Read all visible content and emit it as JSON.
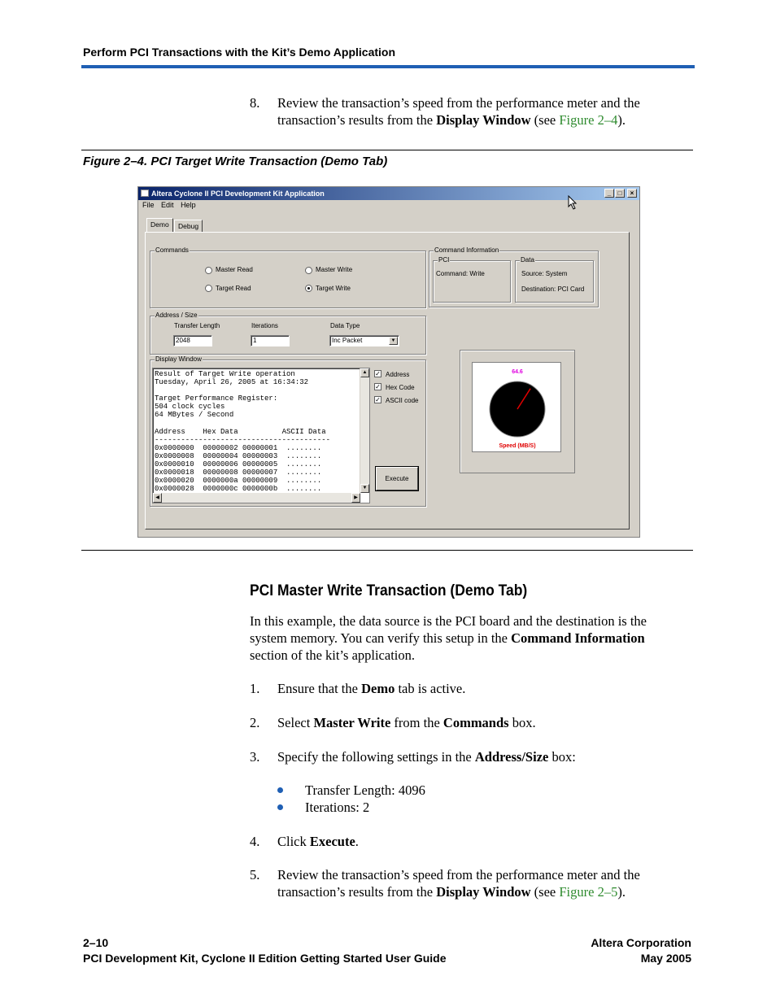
{
  "header": {
    "title": "Perform PCI Transactions with the Kit’s Demo Application"
  },
  "step8": {
    "number": "8.",
    "line1": "Review the transaction’s speed from the performance meter and the",
    "line2_pre": "transaction’s results from the ",
    "line2_bold": "Display Window",
    "line2_mid": " (see ",
    "line2_link": "Figure 2–4",
    "line2_post": ")."
  },
  "figure": {
    "caption": "Figure 2–4. PCI Target Write Transaction (Demo Tab)",
    "window_title": "Altera Cyclone II PCI Development Kit Application",
    "menu": [
      "File",
      "Edit",
      "Help"
    ],
    "tabs": [
      "Demo",
      "Debug"
    ],
    "commands": {
      "label": "Commands",
      "master_read": "Master Read",
      "master_write": "Master Write",
      "target_read": "Target Read",
      "target_write": "Target Write",
      "selected": "Target Write"
    },
    "command_info": {
      "label": "Command Information",
      "pci_label": "PCI",
      "command": "Command: Write",
      "data_label": "Data",
      "source": "Source: System",
      "destination": "Destination: PCI Card"
    },
    "address_size": {
      "label": "Address / Size",
      "transfer_length_label": "Transfer Length",
      "transfer_length": "2048",
      "iterations_label": "Iterations",
      "iterations": "1",
      "data_type_label": "Data Type",
      "data_type": "Inc Packet"
    },
    "display_window": {
      "label": "Display Window",
      "text": "Result of Target Write operation\nTuesday, April 26, 2005 at 16:34:32\n\nTarget Performance Register:\n504 clock cycles\n64 MBytes / Second\n\nAddress    Hex Data          ASCII Data\n----------------------------------------\n0x0000000  00000002 00000001  ........\n0x0000008  00000004 00000003  ........\n0x0000010  00000006 00000005  ........\n0x0000018  00000008 00000007  ........\n0x0000020  0000000a 00000009  ........\n0x0000028  0000000c 0000000b  ........",
      "checkbox_address": "Address",
      "checkbox_hex": "Hex Code",
      "checkbox_ascii": "ASCII code",
      "execute": "Execute"
    },
    "meter": {
      "value": "64.6",
      "label": "Speed (MB/S)",
      "needle_fraction": 0.62
    }
  },
  "section": {
    "title": "PCI Master Write Transaction (Demo Tab)",
    "intro_l1": "In this example, the data source is the PCI board and the destination is the",
    "intro_l2_pre": "system memory. You can verify this setup in the ",
    "intro_l2_bold": "Command Information",
    "intro_l3": "section of the kit’s application.",
    "s1_num": "1.",
    "s1_pre": "Ensure that the ",
    "s1_bold": "Demo",
    "s1_post": " tab is active.",
    "s2_num": "2.",
    "s2_pre": "Select ",
    "s2_bold1": "Master Write",
    "s2_mid": " from the ",
    "s2_bold2": "Commands",
    "s2_post": " box.",
    "s3_num": "3.",
    "s3_pre": "Specify the following settings in the ",
    "s3_bold": "Address/Size",
    "s3_post": " box:",
    "b1": "Transfer Length: 4096",
    "b2": "Iterations: 2",
    "s4_num": "4.",
    "s4_pre": "Click ",
    "s4_bold": "Execute",
    "s4_post": ".",
    "s5_num": "5.",
    "s5_l1": "Review the transaction’s speed from the performance meter and the",
    "s5_l2_pre": "transaction’s results from the ",
    "s5_l2_bold": "Display Window",
    "s5_l2_mid": " (see ",
    "s5_l2_link": "Figure 2–5",
    "s5_l2_post": ")."
  },
  "footer": {
    "page": "2–10",
    "guide": "PCI Development Kit, Cyclone II Edition Getting Started User Guide",
    "company": "Altera Corporation",
    "date": "May 2005"
  },
  "colors": {
    "rule": "#1f5fb4",
    "link": "#2e8b2e",
    "meter_value": "#e000e0",
    "meter_label": "#e00000"
  }
}
